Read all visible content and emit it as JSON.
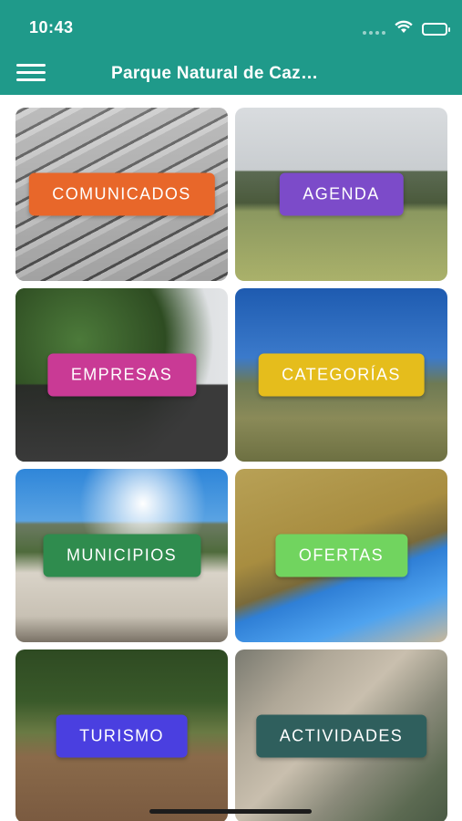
{
  "status_bar": {
    "time": "10:43",
    "icons": [
      "signal-icon",
      "wifi-icon",
      "battery-icon"
    ]
  },
  "app_bar": {
    "menu_icon": "hamburger-menu-icon",
    "title": "Parque Natural de Caz…"
  },
  "theme": {
    "primary": "#1f9a8a"
  },
  "tiles": [
    {
      "label": "COMUNICADOS",
      "color": "#e8672a"
    },
    {
      "label": "AGENDA",
      "color": "#7c4bc9"
    },
    {
      "label": "EMPRESAS",
      "color": "#c93a95"
    },
    {
      "label": "CATEGORÍAS",
      "color": "#e5bd1c"
    },
    {
      "label": "MUNICIPIOS",
      "color": "#2f8c4e"
    },
    {
      "label": "OFERTAS",
      "color": "#71d45f"
    },
    {
      "label": "TURISMO",
      "color": "#4a3fe0"
    },
    {
      "label": "ACTIVIDADES",
      "color": "#2f5f5d"
    }
  ]
}
